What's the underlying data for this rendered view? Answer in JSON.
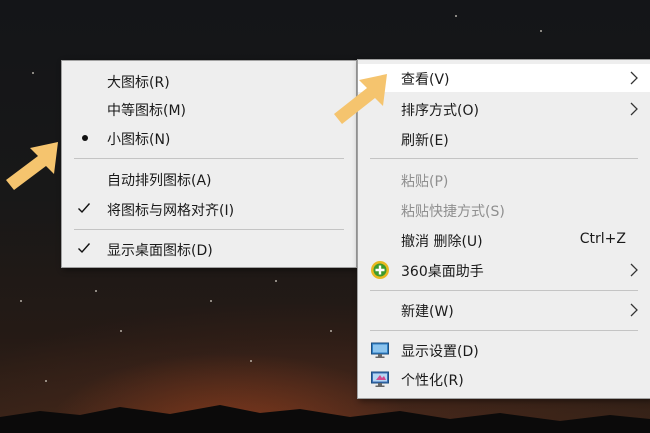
{
  "view_submenu": {
    "items": [
      {
        "label": "大图标(R)"
      },
      {
        "label": "中等图标(M)"
      },
      {
        "label": "小图标(N)"
      },
      {
        "label": "自动排列图标(A)"
      },
      {
        "label": "将图标与网格对齐(I)"
      },
      {
        "label": "显示桌面图标(D)"
      }
    ]
  },
  "context_menu": {
    "items": [
      {
        "label": "查看(V)"
      },
      {
        "label": "排序方式(O)"
      },
      {
        "label": "刷新(E)"
      },
      {
        "label": "粘贴(P)"
      },
      {
        "label": "粘贴快捷方式(S)"
      },
      {
        "label": "撤消 删除(U)",
        "shortcut": "Ctrl+Z"
      },
      {
        "label": "360桌面助手"
      },
      {
        "label": "新建(W)"
      },
      {
        "label": "显示设置(D)"
      },
      {
        "label": "个性化(R)"
      }
    ]
  },
  "colors": {
    "menu_bg": "#eeeeee",
    "highlight": "#ffffff",
    "disabled_text": "#8f8f8f",
    "arrow": "#f5c46e"
  },
  "icons": [
    "check-icon",
    "radio-dot-icon",
    "chevron-right-icon",
    "360-assistant-icon",
    "display-settings-icon",
    "personalize-icon",
    "pointer-arrow-icon"
  ]
}
